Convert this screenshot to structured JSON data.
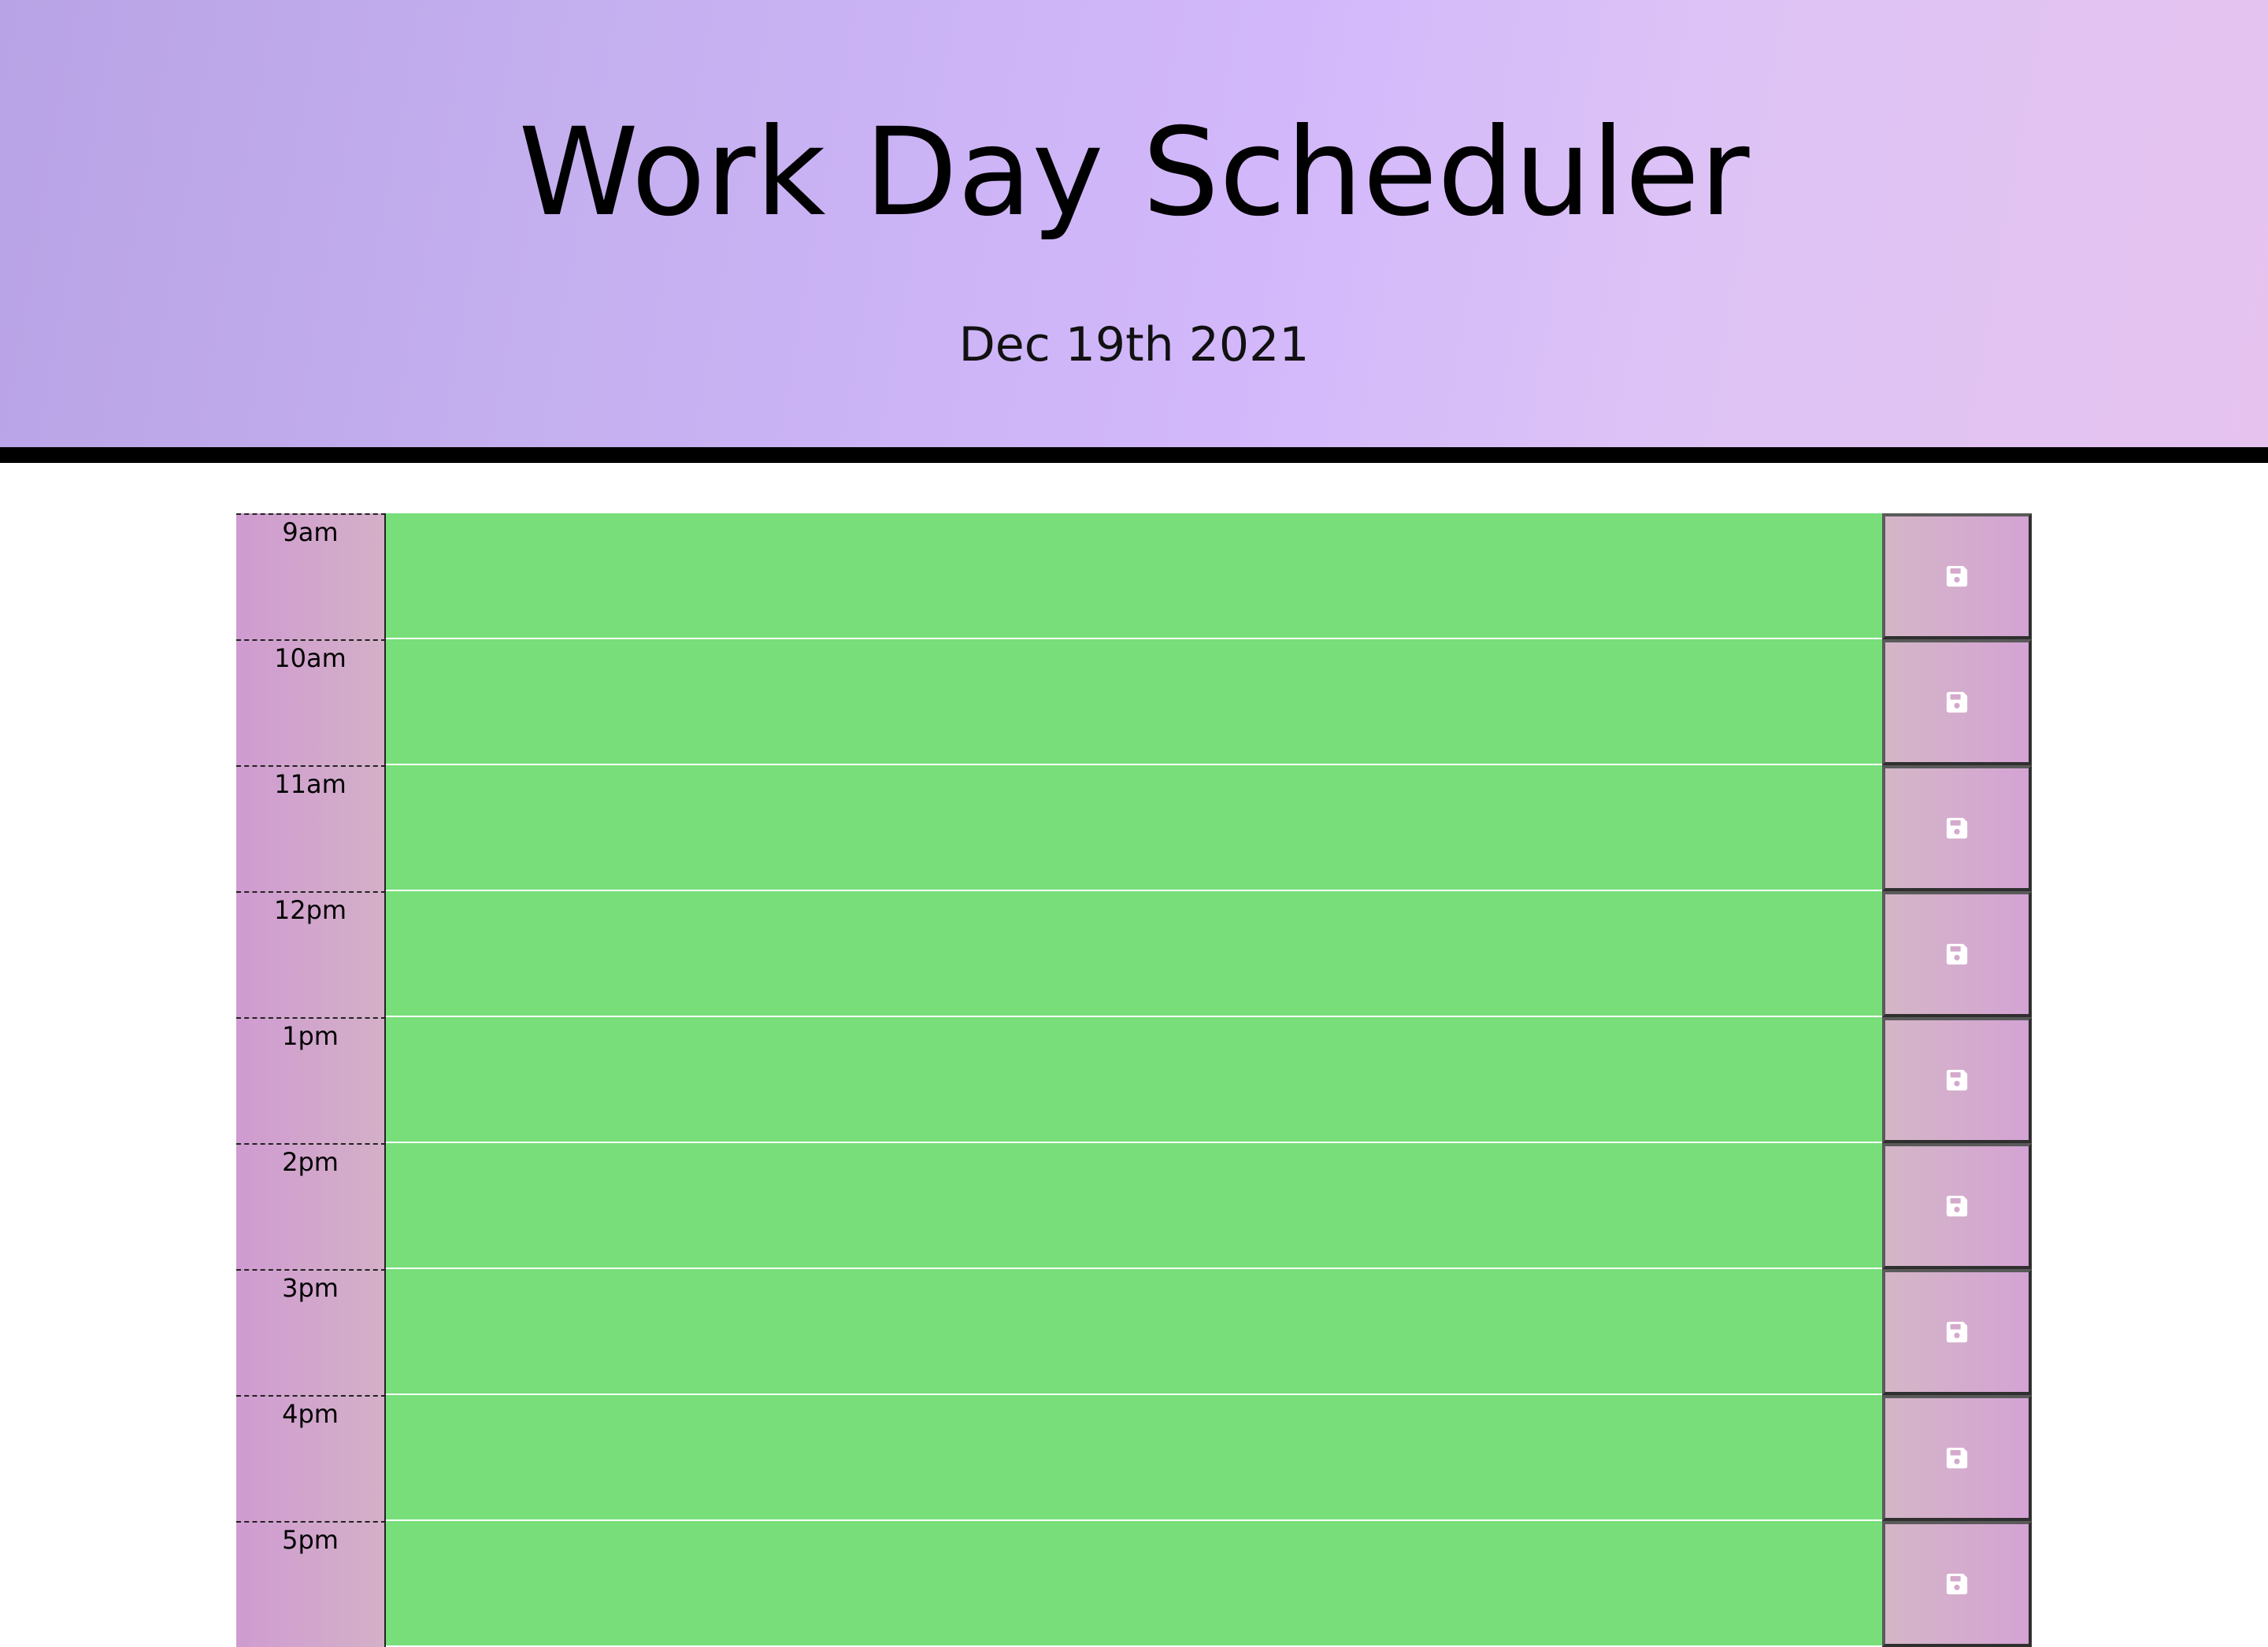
{
  "header": {
    "title": "Work Day Scheduler",
    "current_day": "Dec 19th 2021"
  },
  "colors": {
    "present": "#77de7a",
    "hour_gradient": [
      "#cf9bd0",
      "#d4b0c8"
    ],
    "save_gradient": [
      "#d4b6c6",
      "#d4a3d4"
    ],
    "header_gradient": [
      "#b8a3e6",
      "#e6c3ef"
    ]
  },
  "timeblocks": [
    {
      "hour": "9am",
      "description": "",
      "state": "present",
      "save_icon": "save-icon"
    },
    {
      "hour": "10am",
      "description": "",
      "state": "present",
      "save_icon": "save-icon"
    },
    {
      "hour": "11am",
      "description": "",
      "state": "present",
      "save_icon": "save-icon"
    },
    {
      "hour": "12pm",
      "description": "",
      "state": "present",
      "save_icon": "save-icon"
    },
    {
      "hour": "1pm",
      "description": "",
      "state": "present",
      "save_icon": "save-icon"
    },
    {
      "hour": "2pm",
      "description": "",
      "state": "present",
      "save_icon": "save-icon"
    },
    {
      "hour": "3pm",
      "description": "",
      "state": "present",
      "save_icon": "save-icon"
    },
    {
      "hour": "4pm",
      "description": "",
      "state": "present",
      "save_icon": "save-icon"
    },
    {
      "hour": "5pm",
      "description": "",
      "state": "present",
      "save_icon": "save-icon"
    }
  ]
}
